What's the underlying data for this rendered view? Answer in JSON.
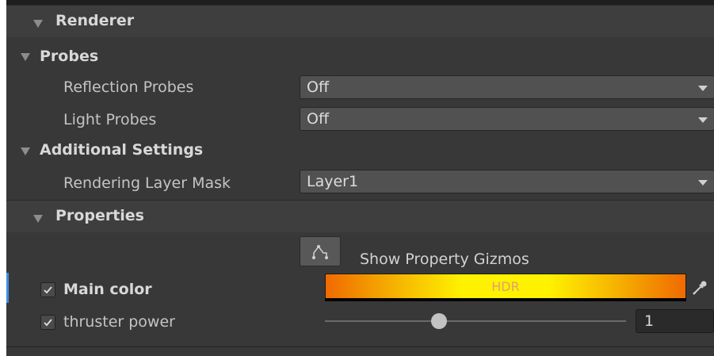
{
  "renderer": {
    "title": "Renderer"
  },
  "probes": {
    "title": "Probes",
    "reflection_label": "Reflection Probes",
    "reflection_value": "Off",
    "light_label": "Light Probes",
    "light_value": "Off"
  },
  "additional": {
    "title": "Additional Settings",
    "mask_label": "Rendering Layer Mask",
    "mask_value": "Layer1"
  },
  "properties": {
    "title": "Properties",
    "gizmo_button_label": "Show Property Gizmos",
    "main_color": {
      "label": "Main color",
      "checked": true,
      "hdr_text": "HDR"
    },
    "thruster_power": {
      "label": "thruster power",
      "checked": true,
      "value": "1",
      "slider_fraction": 0.38
    }
  },
  "colors": {
    "panel_bg": "#383838",
    "accent_mark": "#3d8fe0",
    "gradient_orange": "#f06a00",
    "gradient_yellow": "#fff200"
  },
  "icons": [
    "foldout-triangle-icon",
    "dropdown-arrow-icon",
    "gizmo-icon",
    "check-icon",
    "eyedropper-icon"
  ]
}
